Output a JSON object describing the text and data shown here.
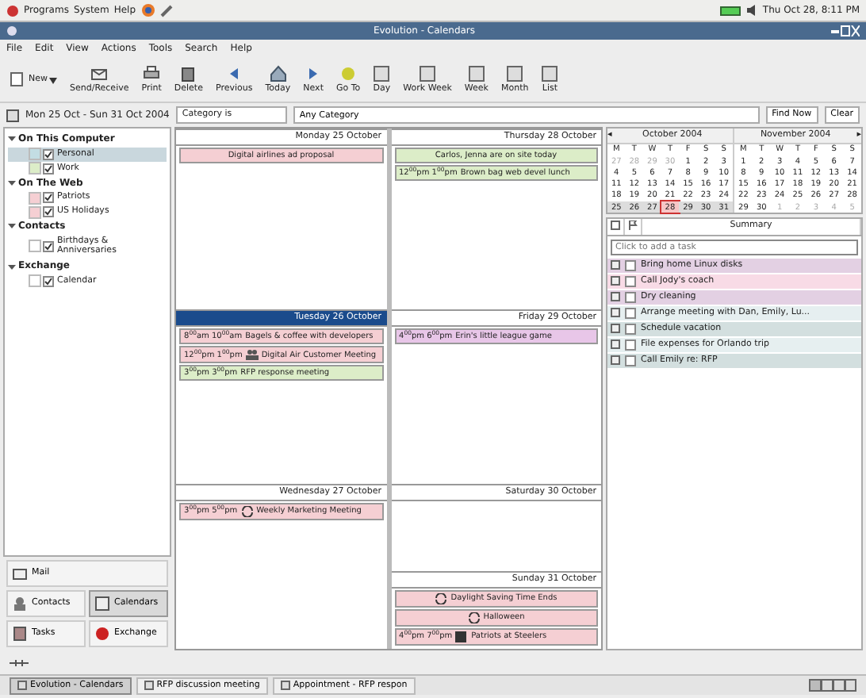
{
  "top_panel": {
    "menus": [
      "Programs",
      "System",
      "Help"
    ],
    "clock": "Thu Oct 28,  8:11 PM"
  },
  "window": {
    "title": "Evolution - Calendars"
  },
  "menubar": [
    "File",
    "Edit",
    "View",
    "Actions",
    "Tools",
    "Search",
    "Help"
  ],
  "toolbar": [
    {
      "label": "New",
      "kind": "new"
    },
    {
      "label": "Send/Receive",
      "kind": "sendrecv"
    },
    {
      "label": "Print",
      "kind": "print"
    },
    {
      "label": "Delete",
      "kind": "delete"
    },
    {
      "label": "Previous",
      "kind": "prev"
    },
    {
      "label": "Today",
      "kind": "today"
    },
    {
      "label": "Next",
      "kind": "next"
    },
    {
      "label": "Go To",
      "kind": "goto"
    },
    {
      "label": "Day",
      "kind": "view"
    },
    {
      "label": "Work Week",
      "kind": "view"
    },
    {
      "label": "Week",
      "kind": "view"
    },
    {
      "label": "Month",
      "kind": "view"
    },
    {
      "label": "List",
      "kind": "view"
    }
  ],
  "searchbar": {
    "range": "Mon 25 Oct - Sun 31 Oct 2004",
    "condition": "Category is",
    "value": "Any Category",
    "buttons": [
      "Find Now",
      "Clear"
    ]
  },
  "sources": [
    {
      "label": "On This Computer",
      "expanded": true,
      "children": [
        {
          "label": "Personal",
          "checked": true,
          "selected": true,
          "color": "#c3dde3"
        },
        {
          "label": "Work",
          "checked": true,
          "selected": false,
          "color": "#dcedc8"
        }
      ]
    },
    {
      "label": "On The Web",
      "expanded": true,
      "children": [
        {
          "label": "Patriots",
          "checked": true,
          "selected": false,
          "color": "#f5cfd3"
        },
        {
          "label": "US Holidays",
          "checked": true,
          "selected": false,
          "color": "#f5cfd3"
        }
      ]
    },
    {
      "label": "Contacts",
      "expanded": true,
      "children": [
        {
          "label": "Birthdays & Anniversaries",
          "checked": true,
          "selected": false,
          "color": "#ffffff"
        }
      ]
    },
    {
      "label": "Exchange",
      "expanded": true,
      "children": [
        {
          "label": "Calendar",
          "checked": true,
          "selected": false,
          "color": "#ffffff"
        }
      ]
    }
  ],
  "switcher": [
    {
      "label": "Mail",
      "kind": "mail",
      "selected": false
    },
    {
      "label": "Contacts",
      "kind": "contacts",
      "selected": false
    },
    {
      "label": "Calendars",
      "kind": "calendars",
      "selected": true
    },
    {
      "label": "Tasks",
      "kind": "tasks",
      "selected": false
    },
    {
      "label": "Exchange",
      "kind": "exchange",
      "selected": false
    }
  ],
  "week": [
    {
      "label": "Monday 25 October",
      "selected": false,
      "events": [
        {
          "kind": "plain",
          "title": "Digital airlines ad proposal",
          "color": "#f5cfd3"
        }
      ]
    },
    {
      "label": "Tuesday 26 October",
      "selected": true,
      "events": [
        {
          "kind": "plain",
          "time": "8$^{00}$am 10$^{00}$am",
          "title": "Bagels & coffee with developers",
          "color": "#f5cfd3"
        },
        {
          "kind": "meeting",
          "time": "12$^{00}$pm  1$^{00}$pm",
          "title": "Digital Air Customer Meeting",
          "color": "#f5cfd3"
        },
        {
          "kind": "plain",
          "time": "3$^{00}$pm  3$^{00}$pm",
          "title": "RFP response meeting",
          "color": "#dcedc8"
        }
      ]
    },
    {
      "label": "Wednesday 27 October",
      "selected": false,
      "events": [
        {
          "kind": "recurring",
          "time": "3$^{00}$pm  5$^{00}$pm",
          "title": "Weekly Marketing Meeting",
          "color": "#f5cfd3"
        }
      ]
    },
    {
      "label": "Thursday 28 October",
      "selected": false,
      "events": [
        {
          "kind": "plain",
          "title": "Carlos, Jenna are on site today",
          "color": "#dcedc8"
        },
        {
          "kind": "plain",
          "time": "12$^{00}$pm  1$^{00}$pm",
          "title": "Brown bag web devel lunch",
          "color": "#dcedc8"
        }
      ]
    },
    {
      "label": "Friday 29 October",
      "selected": false,
      "events": [
        {
          "kind": "plain",
          "time": "4$^{00}$pm  6$^{00}$pm",
          "title": "Erin's little league game",
          "color": "#e8c6e8"
        }
      ]
    },
    {
      "label": "Saturday 30 October",
      "selected": false
    },
    {
      "label": "Sunday 31 October",
      "selected": false,
      "events": [
        {
          "kind": "recurring",
          "title": "Daylight Saving Time Ends",
          "color": "#f5cfd3"
        },
        {
          "kind": "recurring",
          "title": "Halloween",
          "color": "#f5cfd3"
        },
        {
          "kind": "game",
          "time": "4$^{00}$pm  7$^{00}$pm",
          "title": "Patriots at Steelers",
          "color": "#f5cfd3"
        }
      ]
    }
  ],
  "months": [
    {
      "title": "October 2004",
      "arrow": "◂",
      "weekdays": [
        "M",
        "T",
        "W",
        "T",
        "F",
        "S",
        "S"
      ],
      "weeks": [
        {
          "selected": false,
          "days": [
            {
              "d": "27",
              "muted": true,
              "today": false
            },
            {
              "d": "28",
              "muted": true,
              "today": false
            },
            {
              "d": "29",
              "muted": true,
              "today": false
            },
            {
              "d": "30",
              "muted": true,
              "today": false
            },
            {
              "d": "1",
              "muted": false,
              "today": false
            },
            {
              "d": "2",
              "muted": false,
              "today": false
            },
            {
              "d": "3",
              "muted": false,
              "today": false
            }
          ]
        },
        {
          "selected": false,
          "days": [
            {
              "d": "4",
              "muted": false,
              "today": false
            },
            {
              "d": "5",
              "muted": false,
              "today": false
            },
            {
              "d": "6",
              "muted": false,
              "today": false
            },
            {
              "d": "7",
              "muted": false,
              "today": false
            },
            {
              "d": "8",
              "muted": false,
              "today": false
            },
            {
              "d": "9",
              "muted": false,
              "today": false
            },
            {
              "d": "10",
              "muted": false,
              "today": false
            }
          ]
        },
        {
          "selected": false,
          "days": [
            {
              "d": "11",
              "muted": false,
              "today": false
            },
            {
              "d": "12",
              "muted": false,
              "today": false
            },
            {
              "d": "13",
              "muted": false,
              "today": false
            },
            {
              "d": "14",
              "muted": false,
              "today": false
            },
            {
              "d": "15",
              "muted": false,
              "today": false
            },
            {
              "d": "16",
              "muted": false,
              "today": false
            },
            {
              "d": "17",
              "muted": false,
              "today": false
            }
          ]
        },
        {
          "selected": false,
          "days": [
            {
              "d": "18",
              "muted": false,
              "today": false
            },
            {
              "d": "19",
              "muted": false,
              "today": false
            },
            {
              "d": "20",
              "muted": false,
              "today": false
            },
            {
              "d": "21",
              "muted": false,
              "today": false
            },
            {
              "d": "22",
              "muted": false,
              "today": false
            },
            {
              "d": "23",
              "muted": false,
              "today": false
            },
            {
              "d": "24",
              "muted": false,
              "today": false
            }
          ]
        },
        {
          "selected": true,
          "days": [
            {
              "d": "25",
              "muted": false,
              "today": false
            },
            {
              "d": "26",
              "muted": false,
              "today": false
            },
            {
              "d": "27",
              "muted": false,
              "today": false
            },
            {
              "d": "28",
              "muted": false,
              "today": true
            },
            {
              "d": "29",
              "muted": false,
              "today": false
            },
            {
              "d": "30",
              "muted": false,
              "today": false
            },
            {
              "d": "31",
              "muted": false,
              "today": false
            }
          ]
        }
      ]
    },
    {
      "title": "November 2004",
      "arrow": "▸",
      "weekdays": [
        "M",
        "T",
        "W",
        "T",
        "F",
        "S",
        "S"
      ],
      "weeks": [
        {
          "selected": false,
          "days": [
            {
              "d": "1",
              "muted": false,
              "today": false
            },
            {
              "d": "2",
              "muted": false,
              "today": false
            },
            {
              "d": "3",
              "muted": false,
              "today": false
            },
            {
              "d": "4",
              "muted": false,
              "today": false
            },
            {
              "d": "5",
              "muted": false,
              "today": false
            },
            {
              "d": "6",
              "muted": false,
              "today": false
            },
            {
              "d": "7",
              "muted": false,
              "today": false
            }
          ]
        },
        {
          "selected": false,
          "days": [
            {
              "d": "8",
              "muted": false,
              "today": false
            },
            {
              "d": "9",
              "muted": false,
              "today": false
            },
            {
              "d": "10",
              "muted": false,
              "today": false
            },
            {
              "d": "11",
              "muted": false,
              "today": false
            },
            {
              "d": "12",
              "muted": false,
              "today": false
            },
            {
              "d": "13",
              "muted": false,
              "today": false
            },
            {
              "d": "14",
              "muted": false,
              "today": false
            }
          ]
        },
        {
          "selected": false,
          "days": [
            {
              "d": "15",
              "muted": false,
              "today": false
            },
            {
              "d": "16",
              "muted": false,
              "today": false
            },
            {
              "d": "17",
              "muted": false,
              "today": false
            },
            {
              "d": "18",
              "muted": false,
              "today": false
            },
            {
              "d": "19",
              "muted": false,
              "today": false
            },
            {
              "d": "20",
              "muted": false,
              "today": false
            },
            {
              "d": "21",
              "muted": false,
              "today": false
            }
          ]
        },
        {
          "selected": false,
          "days": [
            {
              "d": "22",
              "muted": false,
              "today": false
            },
            {
              "d": "23",
              "muted": false,
              "today": false
            },
            {
              "d": "24",
              "muted": false,
              "today": false
            },
            {
              "d": "25",
              "muted": false,
              "today": false
            },
            {
              "d": "26",
              "muted": false,
              "today": false
            },
            {
              "d": "27",
              "muted": false,
              "today": false
            },
            {
              "d": "28",
              "muted": false,
              "today": false
            }
          ]
        },
        {
          "selected": false,
          "days": [
            {
              "d": "29",
              "muted": false,
              "today": false
            },
            {
              "d": "30",
              "muted": false,
              "today": false
            },
            {
              "d": "1",
              "muted": true,
              "today": false
            },
            {
              "d": "2",
              "muted": true,
              "today": false
            },
            {
              "d": "3",
              "muted": true,
              "today": false
            },
            {
              "d": "4",
              "muted": true,
              "today": false
            },
            {
              "d": "5",
              "muted": true,
              "today": false
            }
          ]
        }
      ]
    }
  ],
  "tasks": {
    "column": "Summary",
    "placeholder": "Click to add a task",
    "items": [
      {
        "title": "Bring home Linux disks",
        "done": false,
        "color": "#e3d0e3"
      },
      {
        "title": "Call Jody's coach",
        "done": false,
        "color": "#f8dbe6"
      },
      {
        "title": "Dry cleaning",
        "done": false,
        "color": "#e3d0e3"
      },
      {
        "title": "Arrange meeting with Dan, Emily, Lu...",
        "done": false,
        "color": "#e6eff0"
      },
      {
        "title": "Schedule vacation",
        "done": false,
        "color": "#d3dfdf"
      },
      {
        "title": "File expenses for Orlando trip",
        "done": false,
        "color": "#e6eff0"
      },
      {
        "title": "Call Emily re: RFP",
        "done": false,
        "color": "#d3dfdf"
      }
    ]
  },
  "taskbar": [
    {
      "label": "Evolution - Calendars",
      "selected": true
    },
    {
      "label": "RFP discussion meeting",
      "selected": false
    },
    {
      "label": "Appointment - RFP respon",
      "selected": false
    }
  ]
}
